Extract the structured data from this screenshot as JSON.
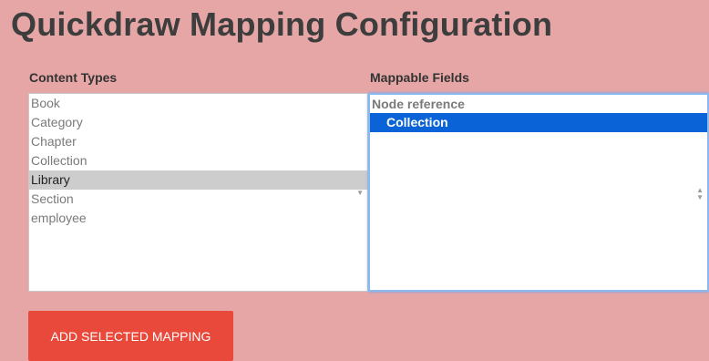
{
  "page": {
    "title": "Quickdraw Mapping Configuration"
  },
  "content_types": {
    "label": "Content Types",
    "options": [
      "Book",
      "Category",
      "Chapter",
      "Collection",
      "Library",
      "Section",
      "employee"
    ],
    "selected": "Library"
  },
  "mappable_fields": {
    "label": "Mappable Fields",
    "group": "Node reference",
    "options": [
      "Collection"
    ],
    "selected": "Collection"
  },
  "actions": {
    "add_label": "ADD SELECTED MAPPING"
  },
  "colors": {
    "background": "#e6a6a6",
    "button": "#e8493a",
    "selected_blue": "#0a64d8",
    "focus_border": "#8cb8f0"
  }
}
